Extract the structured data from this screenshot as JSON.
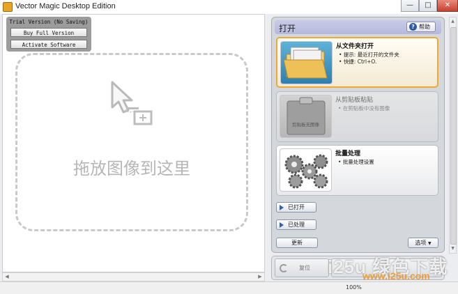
{
  "window": {
    "title": "Vector Magic Desktop Edition",
    "minimize": "—",
    "maximize": "□",
    "close": "✕"
  },
  "trial": {
    "label": "Trial Version (No Saving)",
    "buy_label": "Buy Full Version",
    "activate_label": "Activate Software"
  },
  "canvas": {
    "drop_text": "拖放图像到这里"
  },
  "panel": {
    "title": "打开",
    "help_label": "帮助",
    "cards": [
      {
        "title": "从文件夹打开",
        "bullets": [
          "提示: 最近打开的文件夹",
          "快捷: Ctrl+O."
        ]
      },
      {
        "title": "从剪贴板粘贴",
        "bullets": [
          "在剪贴板中没有图像"
        ],
        "thumb_label": "剪贴板无图像"
      },
      {
        "title": "批量处理",
        "bullets": [
          "批量处理设置"
        ]
      }
    ],
    "opened_label": "已打开",
    "processed_label": "已处理",
    "update_label": "更新",
    "options_label": "选项"
  },
  "nav": {
    "reset_label": "复位"
  },
  "status": {
    "zoom": "100%"
  },
  "watermark": {
    "line1": "i25u 绿色下载",
    "line2": "www.i25u.com"
  },
  "colors": {
    "accent_selected": "#f0a830",
    "panel_header": "#b5b8dc",
    "help_icon": "#2b5aa8"
  }
}
